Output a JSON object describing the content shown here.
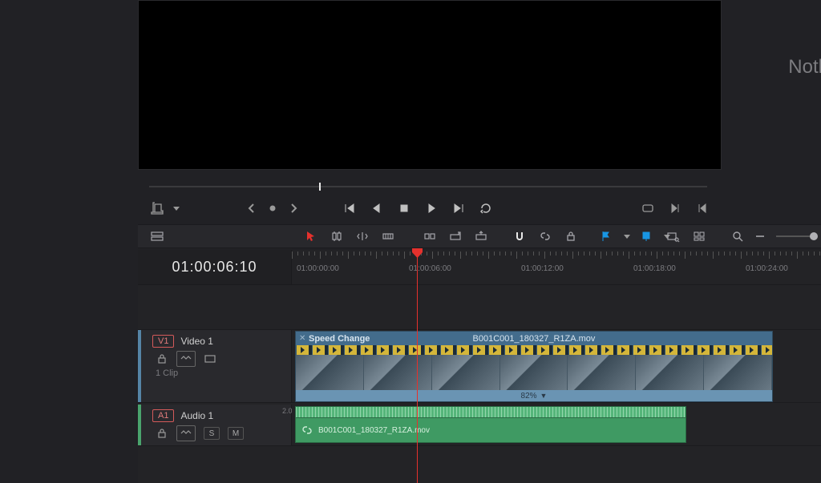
{
  "right_panel_text": "Noth",
  "timecode": "01:00:06:10",
  "ruler": {
    "labels": [
      "01:00:00:00",
      "01:00:06:00",
      "01:00:12:00",
      "01:00:18:00",
      "01:00:24:00"
    ]
  },
  "video_track": {
    "tag": "V1",
    "name": "Video 1",
    "clip_count": "1 Clip",
    "clip": {
      "fx_label": "Speed Change",
      "clip_name": "B001C001_180327_R1ZA.mov",
      "speed": "82%"
    }
  },
  "audio_track": {
    "tag": "A1",
    "name": "Audio 1",
    "side_number": "2.0",
    "solo": "S",
    "mute": "M",
    "clip": {
      "clip_name": "B001C001_180327_R1ZA.mov"
    }
  }
}
